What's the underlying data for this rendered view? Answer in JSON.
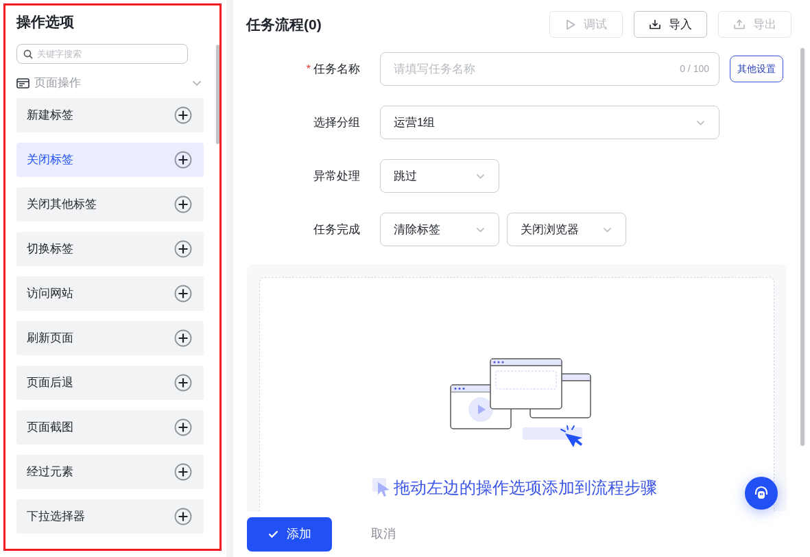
{
  "sidebar": {
    "title": "操作选项",
    "search": {
      "placeholder": "关键字搜索"
    },
    "group": {
      "label": "页面操作",
      "expanded": true
    },
    "items": [
      {
        "label": "新建标签",
        "selected": false
      },
      {
        "label": "关闭标签",
        "selected": true
      },
      {
        "label": "关闭其他标签",
        "selected": false
      },
      {
        "label": "切换标签",
        "selected": false
      },
      {
        "label": "访问网站",
        "selected": false
      },
      {
        "label": "刷新页面",
        "selected": false
      },
      {
        "label": "页面后退",
        "selected": false
      },
      {
        "label": "页面截图",
        "selected": false
      },
      {
        "label": "经过元素",
        "selected": false
      },
      {
        "label": "下拉选择器",
        "selected": false
      }
    ]
  },
  "main": {
    "title": "任务流程(0)",
    "toolbar": [
      {
        "kind": "play",
        "label": "调试",
        "disabled": true
      },
      {
        "kind": "download",
        "label": "导入",
        "disabled": false
      },
      {
        "kind": "upload",
        "label": "导出",
        "disabled": true
      }
    ],
    "form": [
      {
        "label": "任务名称",
        "required_mark": "*",
        "controls": [
          {
            "kind": "text",
            "placeholder": "请填写任务名称",
            "counter": "0 / 100"
          }
        ],
        "button": "其他设置"
      },
      {
        "label": "选择分组",
        "controls": [
          {
            "kind": "select-wide",
            "value": "运营1组"
          }
        ]
      },
      {
        "label": "异常处理",
        "controls": [
          {
            "kind": "select",
            "value": "跳过"
          }
        ]
      },
      {
        "label": "任务完成",
        "controls": [
          {
            "kind": "select",
            "value": "清除标签"
          },
          {
            "kind": "select",
            "value": "关闭浏览器"
          }
        ]
      }
    ],
    "drop_area": {
      "hint": "拖动左边的操作选项添加到流程步骤"
    },
    "footer": {
      "confirm": "添加",
      "cancel": "取消"
    }
  }
}
